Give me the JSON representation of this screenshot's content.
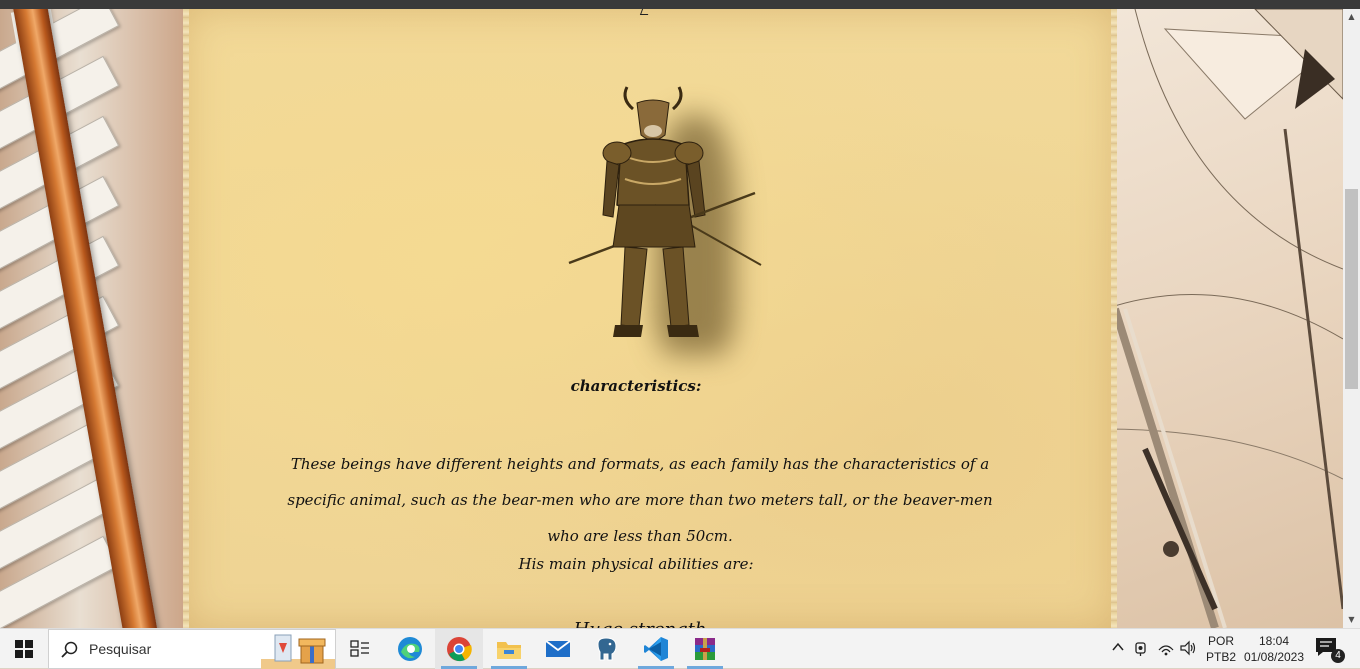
{
  "page": {
    "top_fragment": "/",
    "section_heading": "characteristics:",
    "description": "These beings have different heights and formats, as each family has the characteristics of a specific animal, such as the bear-men who are more than two meters tall, or the beaver-men who are less than 50cm.",
    "abilities_intro": "His main physical abilities are:",
    "cut_off_text": "Huge strength",
    "image_subject": "bull-headed-armored-warrior"
  },
  "scrollbar": {
    "up_arrow": "▲",
    "down_arrow": "▼"
  },
  "taskbar": {
    "search_placeholder": "Pesquisar",
    "apps": [
      {
        "name": "task-view",
        "icon": "task-view-icon"
      },
      {
        "name": "edge",
        "icon": "edge-icon"
      },
      {
        "name": "chrome",
        "icon": "chrome-icon"
      },
      {
        "name": "file-explorer",
        "icon": "folder-icon"
      },
      {
        "name": "mail",
        "icon": "mail-icon"
      },
      {
        "name": "postgresql",
        "icon": "elephant-icon"
      },
      {
        "name": "vscode",
        "icon": "vscode-icon"
      },
      {
        "name": "winrar",
        "icon": "winrar-icon"
      }
    ],
    "tray": {
      "language_top": "POR",
      "language_bottom": "PTB2",
      "time": "18:04",
      "date": "01/08/2023",
      "notification_count": "4"
    }
  }
}
